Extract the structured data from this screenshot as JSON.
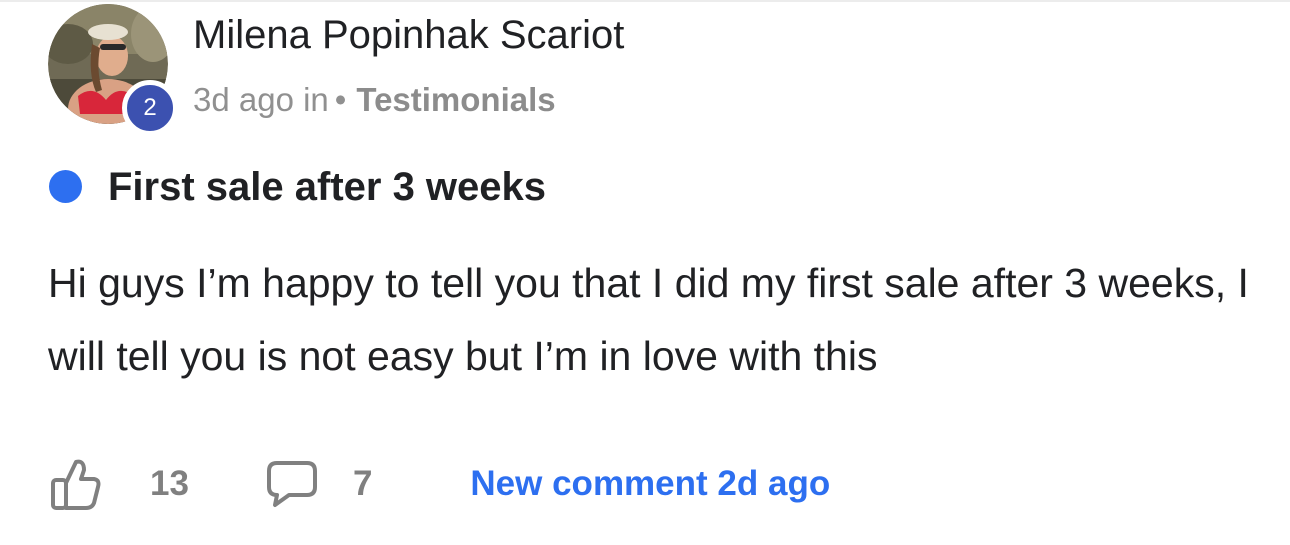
{
  "post": {
    "author": {
      "name": "Milena Popinhak Scariot",
      "level": "2"
    },
    "meta": {
      "time_prefix": "3d ago in",
      "separator": "•",
      "category": "Testimonials"
    },
    "title": "First sale after 3 weeks",
    "body": "Hi guys I’m happy to tell you that I did my first sale after 3 weeks, I will tell you is not easy but I’m in love with this",
    "actions": {
      "like_icon": "thumbs-up-icon",
      "like_count": "13",
      "comment_icon": "comment-bubble-icon",
      "comment_count": "7",
      "new_comment": "New comment 2d ago"
    },
    "colors": {
      "unread_dot": "#2d6ff0",
      "level_badge": "#3c51b0",
      "link": "#2d6ff0"
    }
  }
}
